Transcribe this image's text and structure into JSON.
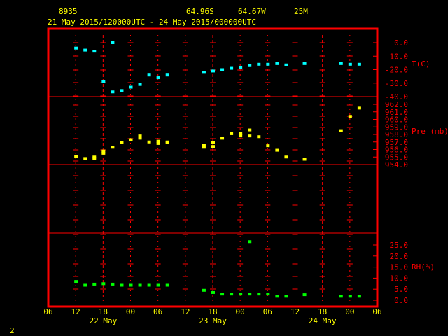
{
  "header": {
    "station": "8935",
    "lat": "64.96S",
    "lon": "64.67W",
    "elev": "25M",
    "period": "21 May 2015/120000UTC - 24 May 2015/000000UTC"
  },
  "footer": {
    "page_number": "2"
  },
  "colors": {
    "background": "#000000",
    "frame": "#ff0000",
    "grid": "#ff0000",
    "header_text": "#ffff00",
    "temperature": "#00ffff",
    "pressure": "#ffff00",
    "rh": "#00ff00"
  },
  "chart_data": [
    {
      "type": "scatter",
      "ylabel": "T(C)",
      "x_unit": "hours since 21 May 2015 12 UTC",
      "ylim": [
        -40,
        0
      ],
      "ytick_labels": [
        "0.0",
        "-10.0",
        "-20.0",
        "-30.0",
        "-40.0"
      ],
      "yticks": [
        0,
        -10,
        -20,
        -30,
        -40
      ],
      "points": [
        {
          "x": 6,
          "y": -4
        },
        {
          "x": 8,
          "y": -5.5
        },
        {
          "x": 10,
          "y": -6.3
        },
        {
          "x": 12,
          "y": -29
        },
        {
          "x": 14,
          "y": 0
        },
        {
          "x": 14,
          "y": -36.5
        },
        {
          "x": 16,
          "y": -35.5
        },
        {
          "x": 18,
          "y": -33
        },
        {
          "x": 20,
          "y": -31
        },
        {
          "x": 22,
          "y": -24
        },
        {
          "x": 24,
          "y": -26
        },
        {
          "x": 26,
          "y": -24
        },
        {
          "x": 34,
          "y": -22
        },
        {
          "x": 36,
          "y": -21
        },
        {
          "x": 38,
          "y": -20
        },
        {
          "x": 40,
          "y": -19
        },
        {
          "x": 42,
          "y": -18.5
        },
        {
          "x": 44,
          "y": -17
        },
        {
          "x": 46,
          "y": -16
        },
        {
          "x": 48,
          "y": -16
        },
        {
          "x": 50,
          "y": -15.5
        },
        {
          "x": 52,
          "y": -16.5
        },
        {
          "x": 56,
          "y": -15.5
        },
        {
          "x": 64,
          "y": -15.5
        },
        {
          "x": 66,
          "y": -16
        },
        {
          "x": 68,
          "y": -16
        }
      ]
    },
    {
      "type": "scatter",
      "ylabel": "Pre (mb)",
      "ylim": [
        954,
        962
      ],
      "ytick_labels": [
        "962.0",
        "961.0",
        "960.0",
        "959.0",
        "958.0",
        "957.0",
        "956.0",
        "955.0",
        "954.0"
      ],
      "yticks": [
        962,
        961,
        960,
        959,
        958,
        957,
        956,
        955,
        954
      ],
      "points": [
        {
          "x": 6,
          "y": 955.1
        },
        {
          "x": 8,
          "y": 954.8
        },
        {
          "x": 10,
          "y": 954.8
        },
        {
          "x": 10,
          "y": 955.0
        },
        {
          "x": 12,
          "y": 955.5
        },
        {
          "x": 12,
          "y": 955.8
        },
        {
          "x": 14,
          "y": 956.3
        },
        {
          "x": 16,
          "y": 956.9
        },
        {
          "x": 18,
          "y": 957.3
        },
        {
          "x": 20,
          "y": 957.5
        },
        {
          "x": 20,
          "y": 957.8
        },
        {
          "x": 22,
          "y": 957.0
        },
        {
          "x": 24,
          "y": 956.8
        },
        {
          "x": 24,
          "y": 957.1
        },
        {
          "x": 26,
          "y": 957.0
        },
        {
          "x": 26,
          "y": 956.9
        },
        {
          "x": 34,
          "y": 956.3
        },
        {
          "x": 34,
          "y": 956.6
        },
        {
          "x": 36,
          "y": 956.4
        },
        {
          "x": 36,
          "y": 956.9
        },
        {
          "x": 38,
          "y": 957.5
        },
        {
          "x": 40,
          "y": 958.1
        },
        {
          "x": 42,
          "y": 958.1
        },
        {
          "x": 42,
          "y": 957.8
        },
        {
          "x": 44,
          "y": 958.6
        },
        {
          "x": 44,
          "y": 957.8
        },
        {
          "x": 46,
          "y": 957.7
        },
        {
          "x": 48,
          "y": 956.5
        },
        {
          "x": 50,
          "y": 955.9
        },
        {
          "x": 52,
          "y": 955.0
        },
        {
          "x": 56,
          "y": 954.7
        },
        {
          "x": 64,
          "y": 958.5
        },
        {
          "x": 66,
          "y": 960.4
        },
        {
          "x": 68,
          "y": 961.5
        }
      ]
    },
    {
      "type": "scatter",
      "ylabel": "RH(%)",
      "ylim": [
        0,
        25
      ],
      "ytick_labels": [
        "25.0",
        "20.0",
        "15.0",
        "10.0",
        "5.0",
        "0.0"
      ],
      "yticks": [
        25,
        20,
        15,
        10,
        5,
        0
      ],
      "points": [
        {
          "x": 6,
          "y": 8.5
        },
        {
          "x": 8,
          "y": 6.8
        },
        {
          "x": 10,
          "y": 7.3
        },
        {
          "x": 12,
          "y": 7.5
        },
        {
          "x": 14,
          "y": 7.3
        },
        {
          "x": 16,
          "y": 6.8
        },
        {
          "x": 18,
          "y": 6.8
        },
        {
          "x": 20,
          "y": 6.8
        },
        {
          "x": 22,
          "y": 6.8
        },
        {
          "x": 24,
          "y": 6.8
        },
        {
          "x": 26,
          "y": 6.8
        },
        {
          "x": 34,
          "y": 4.5
        },
        {
          "x": 36,
          "y": 3.5
        },
        {
          "x": 38,
          "y": 2.8
        },
        {
          "x": 40,
          "y": 2.8
        },
        {
          "x": 42,
          "y": 2.8
        },
        {
          "x": 44,
          "y": 2.8
        },
        {
          "x": 44,
          "y": 26.5
        },
        {
          "x": 46,
          "y": 2.8
        },
        {
          "x": 48,
          "y": 2.8
        },
        {
          "x": 50,
          "y": 1.8
        },
        {
          "x": 52,
          "y": 1.8
        },
        {
          "x": 56,
          "y": 2.5
        },
        {
          "x": 64,
          "y": 1.8
        },
        {
          "x": 66,
          "y": 1.8
        },
        {
          "x": 68,
          "y": 1.8
        }
      ]
    }
  ],
  "x_axis": {
    "tick_labels": [
      "06",
      "12",
      "18",
      "00",
      "06",
      "12",
      "18",
      "00",
      "06",
      "12",
      "18",
      "00",
      "06"
    ],
    "day_labels": [
      {
        "label": "22 May",
        "hour": 12
      },
      {
        "label": "23 May",
        "hour": 36
      },
      {
        "label": "24 May",
        "hour": 60
      }
    ]
  }
}
